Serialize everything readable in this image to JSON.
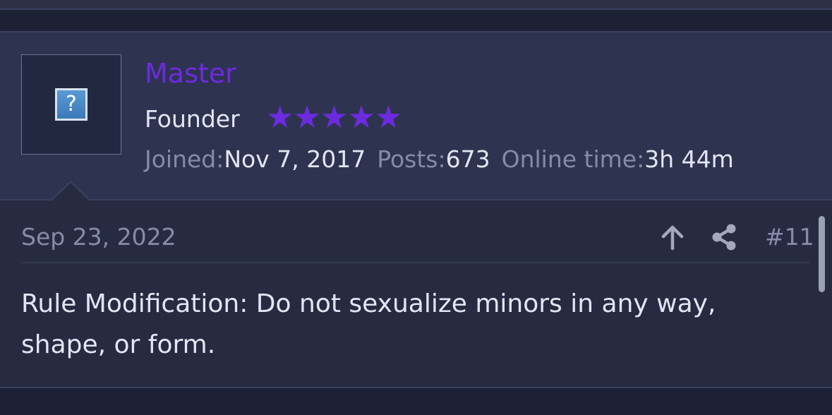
{
  "user": {
    "username": "Master",
    "rank": "Founder",
    "stars": "★★★★★",
    "avatar_placeholder": "?",
    "joined_label": "Joined:",
    "joined_value": "Nov 7, 2017",
    "posts_label": "Posts:",
    "posts_value": "673",
    "online_label": "Online time:",
    "online_value": "3h 44m",
    "rating": 5,
    "username_color": "#6c2be0"
  },
  "post": {
    "date": "Sep 23, 2022",
    "number": "#11",
    "body": "Rule Modification: Do not sexualize minors in any way, shape, or form.",
    "icons": [
      "upvote-arrow-icon",
      "share-icon"
    ]
  }
}
